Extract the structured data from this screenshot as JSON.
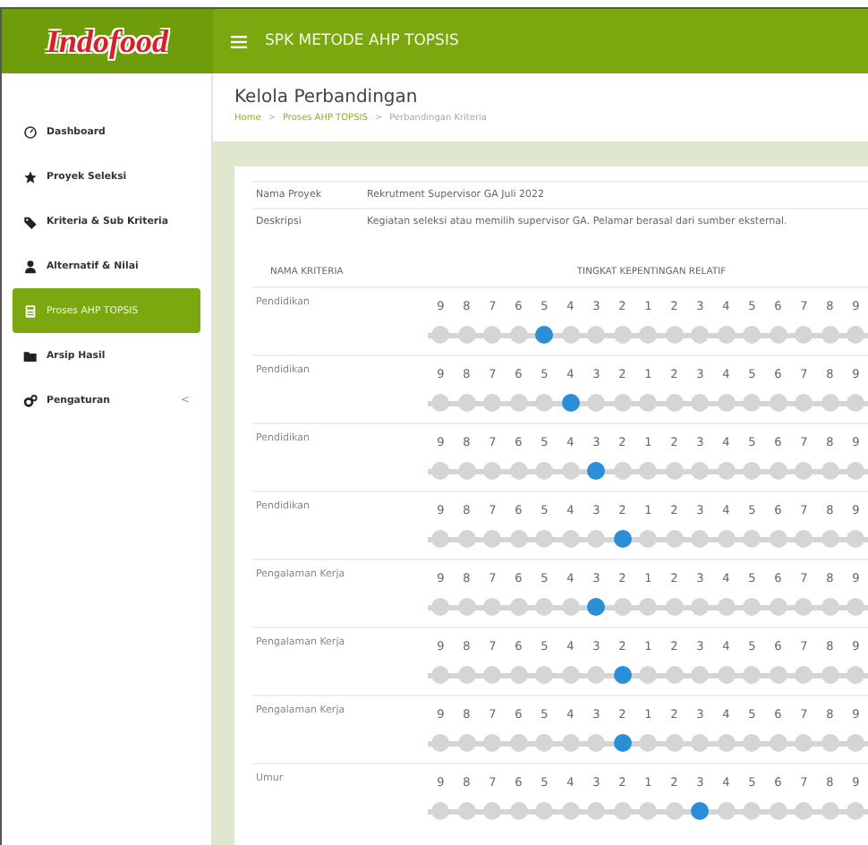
{
  "logo": "Indofood",
  "app_title": "SPK METODE AHP TOPSIS",
  "sidebar": {
    "items": [
      {
        "label": "Dashboard",
        "selected": false
      },
      {
        "label": "Proyek Seleksi",
        "selected": false
      },
      {
        "label": "Kriteria & Sub Kriteria",
        "selected": false
      },
      {
        "label": "Alternatif & Nilai",
        "selected": false
      },
      {
        "label": "Proses AHP TOPSIS",
        "selected": true
      },
      {
        "label": "Arsip Hasil",
        "selected": false
      },
      {
        "label": "Pengaturan",
        "selected": false,
        "chevron": "<"
      }
    ]
  },
  "page": {
    "title": "Kelola Perbandingan",
    "breadcrumb": [
      {
        "label": "Home",
        "link": true
      },
      {
        "label": "Proses AHP TOPSIS",
        "link": true
      },
      {
        "label": "Perbandingan Kriteria",
        "link": false
      }
    ],
    "separators": [
      ">",
      ">"
    ]
  },
  "project": [
    {
      "label": "Nama Proyek",
      "value": "Rekrutment Supervisor GA Juli 2022"
    },
    {
      "label": "Deskripsi",
      "value": "Kegiatan seleksi atau memilih supervisor GA. Pelamar berasal dari sumber eksternal."
    }
  ],
  "table": {
    "columns": [
      "NAMA KRITERIA",
      "TINGKAT KEPENTINGAN RELATIF"
    ],
    "rows": [
      {
        "criterion": "Pendidikan",
        "options": [
          {
            "label": "9",
            "selected": false
          },
          {
            "label": "8",
            "selected": false
          },
          {
            "label": "7",
            "selected": false
          },
          {
            "label": "6",
            "selected": false
          },
          {
            "label": "5",
            "selected": true
          },
          {
            "label": "4",
            "selected": false
          },
          {
            "label": "3",
            "selected": false
          },
          {
            "label": "2",
            "selected": false
          },
          {
            "label": "1",
            "selected": false
          },
          {
            "label": "2",
            "selected": false
          },
          {
            "label": "3",
            "selected": false
          },
          {
            "label": "4",
            "selected": false
          },
          {
            "label": "5",
            "selected": false
          },
          {
            "label": "6",
            "selected": false
          },
          {
            "label": "7",
            "selected": false
          },
          {
            "label": "8",
            "selected": false
          },
          {
            "label": "9",
            "selected": false
          }
        ]
      },
      {
        "criterion": "Pendidikan",
        "options": [
          {
            "label": "9",
            "selected": false
          },
          {
            "label": "8",
            "selected": false
          },
          {
            "label": "7",
            "selected": false
          },
          {
            "label": "6",
            "selected": false
          },
          {
            "label": "5",
            "selected": false
          },
          {
            "label": "4",
            "selected": true
          },
          {
            "label": "3",
            "selected": false
          },
          {
            "label": "2",
            "selected": false
          },
          {
            "label": "1",
            "selected": false
          },
          {
            "label": "2",
            "selected": false
          },
          {
            "label": "3",
            "selected": false
          },
          {
            "label": "4",
            "selected": false
          },
          {
            "label": "5",
            "selected": false
          },
          {
            "label": "6",
            "selected": false
          },
          {
            "label": "7",
            "selected": false
          },
          {
            "label": "8",
            "selected": false
          },
          {
            "label": "9",
            "selected": false
          }
        ]
      },
      {
        "criterion": "Pendidikan",
        "options": [
          {
            "label": "9",
            "selected": false
          },
          {
            "label": "8",
            "selected": false
          },
          {
            "label": "7",
            "selected": false
          },
          {
            "label": "6",
            "selected": false
          },
          {
            "label": "5",
            "selected": false
          },
          {
            "label": "4",
            "selected": false
          },
          {
            "label": "3",
            "selected": true
          },
          {
            "label": "2",
            "selected": false
          },
          {
            "label": "1",
            "selected": false
          },
          {
            "label": "2",
            "selected": false
          },
          {
            "label": "3",
            "selected": false
          },
          {
            "label": "4",
            "selected": false
          },
          {
            "label": "5",
            "selected": false
          },
          {
            "label": "6",
            "selected": false
          },
          {
            "label": "7",
            "selected": false
          },
          {
            "label": "8",
            "selected": false
          },
          {
            "label": "9",
            "selected": false
          }
        ]
      },
      {
        "criterion": "Pendidikan",
        "options": [
          {
            "label": "9",
            "selected": false
          },
          {
            "label": "8",
            "selected": false
          },
          {
            "label": "7",
            "selected": false
          },
          {
            "label": "6",
            "selected": false
          },
          {
            "label": "5",
            "selected": false
          },
          {
            "label": "4",
            "selected": false
          },
          {
            "label": "3",
            "selected": false
          },
          {
            "label": "2",
            "selected": true
          },
          {
            "label": "1",
            "selected": false
          },
          {
            "label": "2",
            "selected": false
          },
          {
            "label": "3",
            "selected": false
          },
          {
            "label": "4",
            "selected": false
          },
          {
            "label": "5",
            "selected": false
          },
          {
            "label": "6",
            "selected": false
          },
          {
            "label": "7",
            "selected": false
          },
          {
            "label": "8",
            "selected": false
          },
          {
            "label": "9",
            "selected": false
          }
        ]
      },
      {
        "criterion": "Pengalaman Kerja",
        "options": [
          {
            "label": "9",
            "selected": false
          },
          {
            "label": "8",
            "selected": false
          },
          {
            "label": "7",
            "selected": false
          },
          {
            "label": "6",
            "selected": false
          },
          {
            "label": "5",
            "selected": false
          },
          {
            "label": "4",
            "selected": false
          },
          {
            "label": "3",
            "selected": true
          },
          {
            "label": "2",
            "selected": false
          },
          {
            "label": "1",
            "selected": false
          },
          {
            "label": "2",
            "selected": false
          },
          {
            "label": "3",
            "selected": false
          },
          {
            "label": "4",
            "selected": false
          },
          {
            "label": "5",
            "selected": false
          },
          {
            "label": "6",
            "selected": false
          },
          {
            "label": "7",
            "selected": false
          },
          {
            "label": "8",
            "selected": false
          },
          {
            "label": "9",
            "selected": false
          }
        ]
      },
      {
        "criterion": "Pengalaman Kerja",
        "options": [
          {
            "label": "9",
            "selected": false
          },
          {
            "label": "8",
            "selected": false
          },
          {
            "label": "7",
            "selected": false
          },
          {
            "label": "6",
            "selected": false
          },
          {
            "label": "5",
            "selected": false
          },
          {
            "label": "4",
            "selected": false
          },
          {
            "label": "3",
            "selected": false
          },
          {
            "label": "2",
            "selected": true
          },
          {
            "label": "1",
            "selected": false
          },
          {
            "label": "2",
            "selected": false
          },
          {
            "label": "3",
            "selected": false
          },
          {
            "label": "4",
            "selected": false
          },
          {
            "label": "5",
            "selected": false
          },
          {
            "label": "6",
            "selected": false
          },
          {
            "label": "7",
            "selected": false
          },
          {
            "label": "8",
            "selected": false
          },
          {
            "label": "9",
            "selected": false
          }
        ]
      },
      {
        "criterion": "Pengalaman Kerja",
        "options": [
          {
            "label": "9",
            "selected": false
          },
          {
            "label": "8",
            "selected": false
          },
          {
            "label": "7",
            "selected": false
          },
          {
            "label": "6",
            "selected": false
          },
          {
            "label": "5",
            "selected": false
          },
          {
            "label": "4",
            "selected": false
          },
          {
            "label": "3",
            "selected": false
          },
          {
            "label": "2",
            "selected": true
          },
          {
            "label": "1",
            "selected": false
          },
          {
            "label": "2",
            "selected": false
          },
          {
            "label": "3",
            "selected": false
          },
          {
            "label": "4",
            "selected": false
          },
          {
            "label": "5",
            "selected": false
          },
          {
            "label": "6",
            "selected": false
          },
          {
            "label": "7",
            "selected": false
          },
          {
            "label": "8",
            "selected": false
          },
          {
            "label": "9",
            "selected": false
          }
        ]
      },
      {
        "criterion": "Umur",
        "options": [
          {
            "label": "9",
            "selected": false
          },
          {
            "label": "8",
            "selected": false
          },
          {
            "label": "7",
            "selected": false
          },
          {
            "label": "6",
            "selected": false
          },
          {
            "label": "5",
            "selected": false
          },
          {
            "label": "4",
            "selected": false
          },
          {
            "label": "3",
            "selected": false
          },
          {
            "label": "2",
            "selected": false
          },
          {
            "label": "1",
            "selected": false
          },
          {
            "label": "2",
            "selected": false
          },
          {
            "label": "3",
            "selected": true
          },
          {
            "label": "4",
            "selected": false
          },
          {
            "label": "5",
            "selected": false
          },
          {
            "label": "6",
            "selected": false
          },
          {
            "label": "7",
            "selected": false
          },
          {
            "label": "8",
            "selected": false
          },
          {
            "label": "9",
            "selected": false
          }
        ]
      }
    ]
  }
}
